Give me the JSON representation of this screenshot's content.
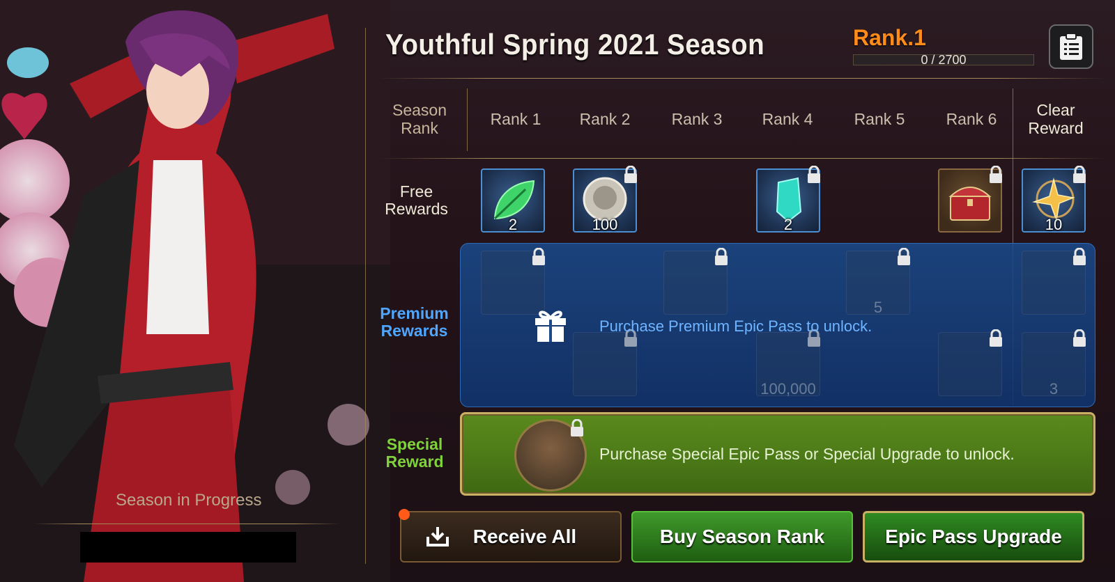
{
  "header": {
    "title": "Youthful Spring 2021 Season",
    "rank_label": "Rank.1",
    "progress_text": "0 / 2700",
    "progress_fraction": 0
  },
  "columns": {
    "season_rank": "Season\nRank",
    "ranks": [
      "Rank 1",
      "Rank 2",
      "Rank 3",
      "Rank 4",
      "Rank 5",
      "Rank 6"
    ],
    "clear_reward": "Clear\nReward"
  },
  "rows": {
    "free_label": "Free\nRewards",
    "premium_label": "Premium\nRewards",
    "special_label": "Special\nReward"
  },
  "free_rewards": [
    {
      "rank": "Rank 1",
      "icon": "leaf-icon",
      "qty": "2",
      "locked": false
    },
    {
      "rank": "Rank 2",
      "icon": "silver-coin-icon",
      "qty": "100",
      "locked": true
    },
    {
      "rank": "Rank 4",
      "icon": "crystal-icon",
      "qty": "2",
      "locked": true
    },
    {
      "rank": "Rank 6",
      "icon": "treasure-chest-icon",
      "qty": "",
      "locked": true
    },
    {
      "rank": "Clear Reward",
      "icon": "star-amulet-icon",
      "qty": "10",
      "locked": true
    }
  ],
  "premium_rewards": {
    "message": "Purchase Premium Epic Pass to unlock.",
    "items": [
      {
        "icon": "feather-icon",
        "qty": ""
      },
      {
        "icon": "gem-pendant-icon",
        "qty": ""
      },
      {
        "icon": "card-icon",
        "qty": "5"
      },
      {
        "icon": "frame-icon",
        "qty": ""
      },
      {
        "icon": "dark-gem-icon",
        "qty": ""
      },
      {
        "icon": "gold-coin-icon",
        "qty": "100,000"
      },
      {
        "icon": "dark-gem-icon",
        "qty": ""
      },
      {
        "icon": "flame-icon",
        "qty": "3"
      }
    ]
  },
  "special_reward": {
    "message": "Purchase Special Epic Pass or Special Upgrade to unlock."
  },
  "season_status": "Season in Progress",
  "buttons": {
    "receive_all": "Receive All",
    "buy_season_rank": "Buy Season Rank",
    "epic_pass_upgrade": "Epic Pass Upgrade"
  },
  "colors": {
    "rank_accent": "#ff8c1a",
    "premium_accent": "#4fa6ff",
    "special_accent": "#7fd23a"
  }
}
